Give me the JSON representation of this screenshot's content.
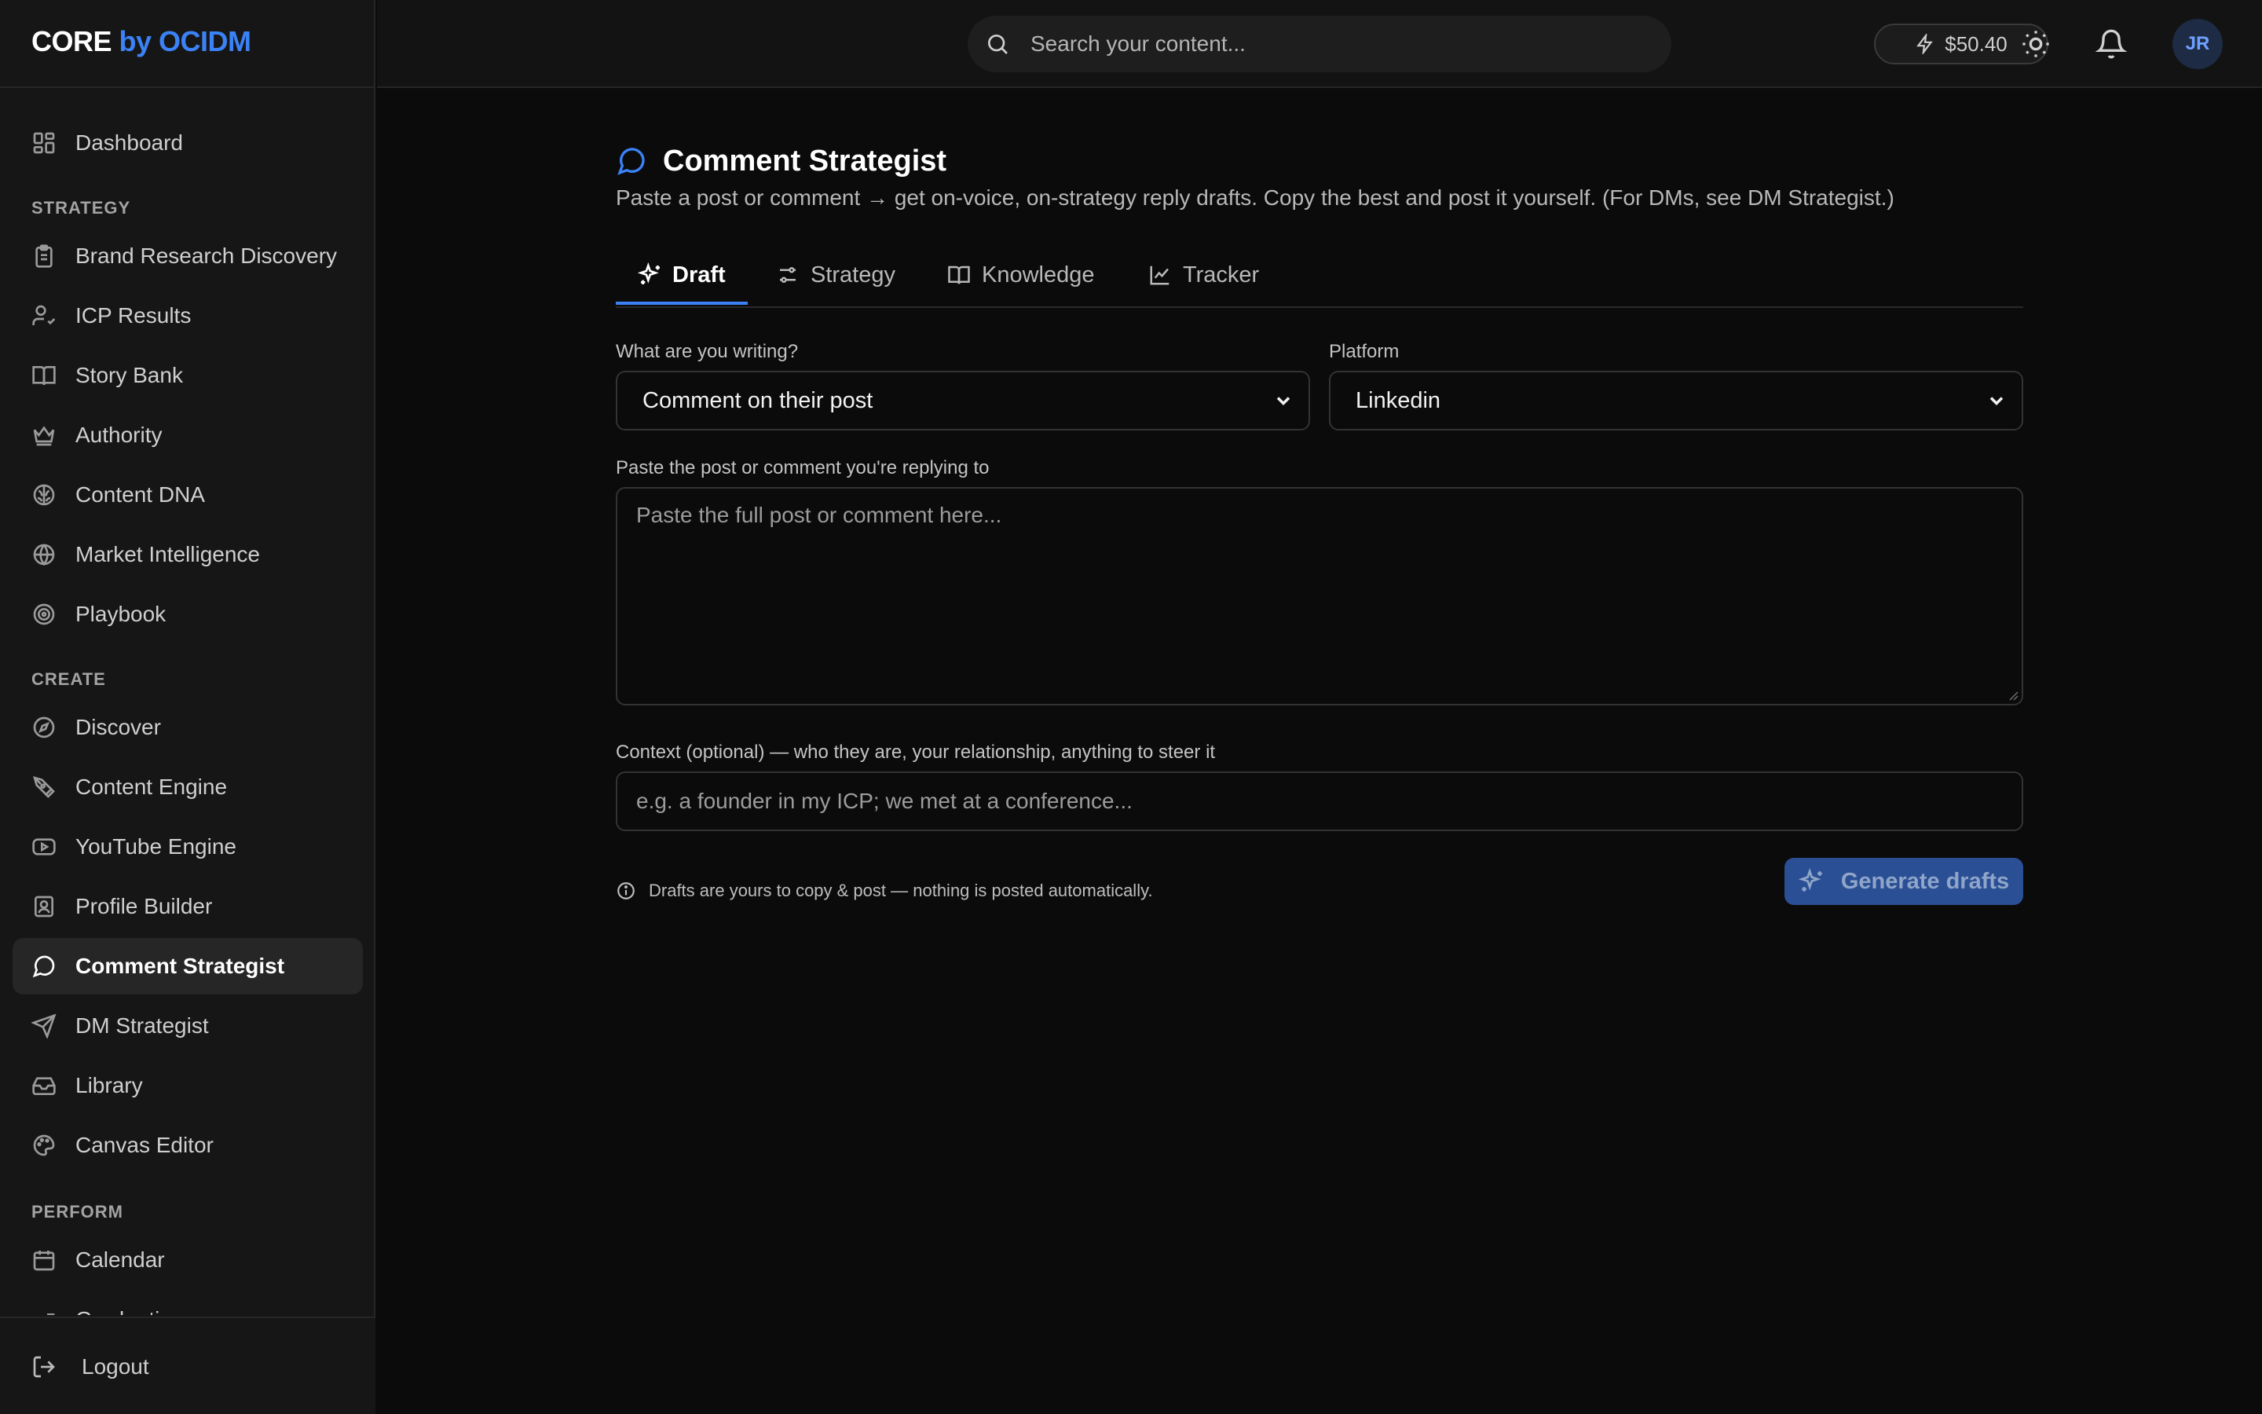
{
  "brand": {
    "part1": "CORE",
    "part2": "by OCIDM",
    "accent_color": "#3b82f6"
  },
  "topbar": {
    "search_placeholder": "Search your content...",
    "credits": "$50.40",
    "avatar_initials": "JR"
  },
  "sidebar": {
    "dashboard": "Dashboard",
    "sections": {
      "strategy": "STRATEGY",
      "create": "CREATE",
      "perform": "PERFORM"
    },
    "strategy_items": [
      {
        "label": "Brand Research Discovery",
        "icon": "clipboard-icon"
      },
      {
        "label": "ICP Results",
        "icon": "user-check-icon"
      },
      {
        "label": "Story Bank",
        "icon": "book-open-icon"
      },
      {
        "label": "Authority",
        "icon": "crown-icon"
      },
      {
        "label": "Content DNA",
        "icon": "brain-icon"
      },
      {
        "label": "Market Intelligence",
        "icon": "globe-icon"
      },
      {
        "label": "Playbook",
        "icon": "target-icon"
      }
    ],
    "create_items": [
      {
        "label": "Discover",
        "icon": "compass-icon"
      },
      {
        "label": "Content Engine",
        "icon": "pen-tool-icon"
      },
      {
        "label": "YouTube Engine",
        "icon": "youtube-icon"
      },
      {
        "label": "Profile Builder",
        "icon": "contact-icon"
      },
      {
        "label": "Comment Strategist",
        "icon": "message-circle-icon",
        "active": true
      },
      {
        "label": "DM Strategist",
        "icon": "send-icon"
      },
      {
        "label": "Library",
        "icon": "inbox-icon"
      },
      {
        "label": "Canvas Editor",
        "icon": "palette-icon"
      }
    ],
    "perform_items": [
      {
        "label": "Calendar",
        "icon": "calendar-icon"
      },
      {
        "label": "Graduation",
        "icon": "trending-icon"
      }
    ],
    "logout": "Logout"
  },
  "page": {
    "title": "Comment Strategist",
    "subtitle": "Paste a post or comment → get on-voice, on-strategy reply drafts. Copy the best and post it yourself. (For DMs, see DM Strategist.)",
    "tabs": [
      {
        "label": "Draft",
        "active": true
      },
      {
        "label": "Strategy"
      },
      {
        "label": "Knowledge"
      },
      {
        "label": "Tracker"
      }
    ]
  },
  "form": {
    "writing_label": "What are you writing?",
    "writing_value": "Comment on their post",
    "platform_label": "Platform",
    "platform_value": "Linkedin",
    "paste_label": "Paste the post or comment you're replying to",
    "paste_placeholder": "Paste the full post or comment here...",
    "context_label": "Context (optional) — who they are, your relationship, anything to steer it",
    "context_placeholder": "e.g. a founder in my ICP; we met at a conference...",
    "note": "Drafts are yours to copy & post — nothing is posted automatically.",
    "generate_label": "Generate drafts"
  }
}
